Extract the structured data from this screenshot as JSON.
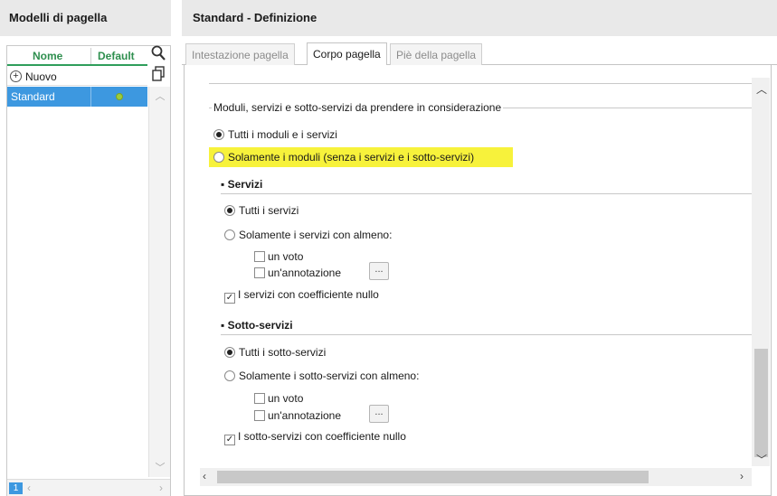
{
  "left": {
    "header": "Modelli di pagella",
    "columns": {
      "name": "Nome",
      "default": "Default"
    },
    "new_label": "Nuovo",
    "rows": [
      {
        "name": "Standard",
        "default": true
      }
    ],
    "page_badge": "1"
  },
  "right": {
    "header": "Standard - Definizione",
    "tabs": [
      {
        "label": "Intestazione pagella",
        "active": false
      },
      {
        "label": "Corpo pagella",
        "active": true
      },
      {
        "label": "Piè della pagella",
        "active": false
      }
    ],
    "group_title": "Moduli, servizi e sotto-servizi da prendere in considerazione",
    "main_options": [
      {
        "label": "Tutti i moduli e i servizi",
        "selected": true
      },
      {
        "label": "Solamente i moduli (senza i servizi e i sotto-servizi)",
        "selected": false,
        "highlighted": true
      }
    ],
    "servizi": {
      "title": "Servizi",
      "opt_all": "Tutti i servizi",
      "opt_some": "Solamente i servizi con almeno:",
      "chk_voto": "un voto",
      "chk_annotazione": "un'annotazione",
      "dots": "...",
      "chk_coeff": "I servizi con coefficiente nullo"
    },
    "sotto_servizi": {
      "title": "Sotto-servizi",
      "opt_all": "Tutti i sotto-servizi",
      "opt_some": "Solamente i sotto-servizi con almeno:",
      "chk_voto": "un voto",
      "chk_annotazione": "un'annotazione",
      "dots": "...",
      "chk_coeff": "I sotto-servizi con coefficiente nullo"
    }
  },
  "colors": {
    "accent_green": "#2f8f4f",
    "selection_blue": "#3d98e0",
    "highlight_yellow": "#f7f23b"
  }
}
